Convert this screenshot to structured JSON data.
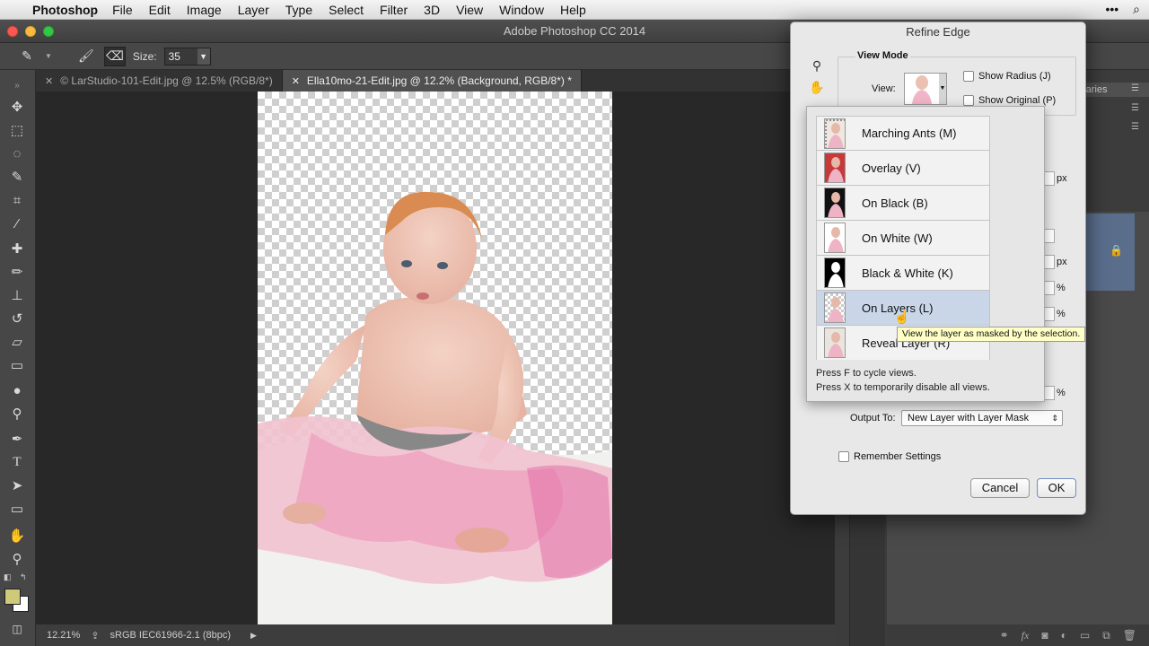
{
  "menubar": {
    "app_name": "Photoshop",
    "items": [
      "File",
      "Edit",
      "Image",
      "Layer",
      "Type",
      "Select",
      "Filter",
      "3D",
      "View",
      "Window",
      "Help"
    ]
  },
  "window": {
    "title": "Adobe Photoshop CC 2014"
  },
  "options_bar": {
    "size_label": "Size:",
    "size_value": "35"
  },
  "tabs": [
    {
      "label": "© LarStudio-101-Edit.jpg @ 12.5% (RGB/8*)",
      "active": false
    },
    {
      "label": "Ella10mo-21-Edit.jpg @ 12.2% (Background, RGB/8*) *",
      "active": true
    }
  ],
  "status_bar": {
    "zoom": "12.21%",
    "profile": "sRGB IEC61966-2.1 (8bpc)"
  },
  "panels": {
    "libraries_tab": "raries"
  },
  "dialog": {
    "title": "Refine Edge",
    "view_mode_title": "View Mode",
    "view_label": "View:",
    "show_radius": "Show Radius (J)",
    "show_original": "Show Original (P)",
    "view_options": [
      {
        "label": "Marching Ants (M)",
        "thumb": "ants"
      },
      {
        "label": "Overlay (V)",
        "thumb": "overlay"
      },
      {
        "label": "On Black (B)",
        "thumb": "black"
      },
      {
        "label": "On White (W)",
        "thumb": "white"
      },
      {
        "label": "Black & White (K)",
        "thumb": "bw"
      },
      {
        "label": "On Layers (L)",
        "thumb": "layers"
      },
      {
        "label": "Reveal Layer (R)",
        "thumb": "reveal"
      }
    ],
    "hint_cycle": "Press F to cycle views.",
    "hint_disable": "Press X to temporarily disable all views.",
    "tooltip": "View the layer as masked by the selection.",
    "unit_px": "px",
    "unit_pct": "%",
    "output_to_label": "Output To:",
    "output_to_value": "New Layer with Layer Mask",
    "remember_settings": "Remember Settings",
    "cancel": "Cancel",
    "ok": "OK"
  },
  "colors": {
    "foreground_swatch": "#cfc97a",
    "background_swatch": "#ffffff",
    "selected_layer": "#5a6e8c",
    "tooltip_bg": "#ffffc6"
  }
}
